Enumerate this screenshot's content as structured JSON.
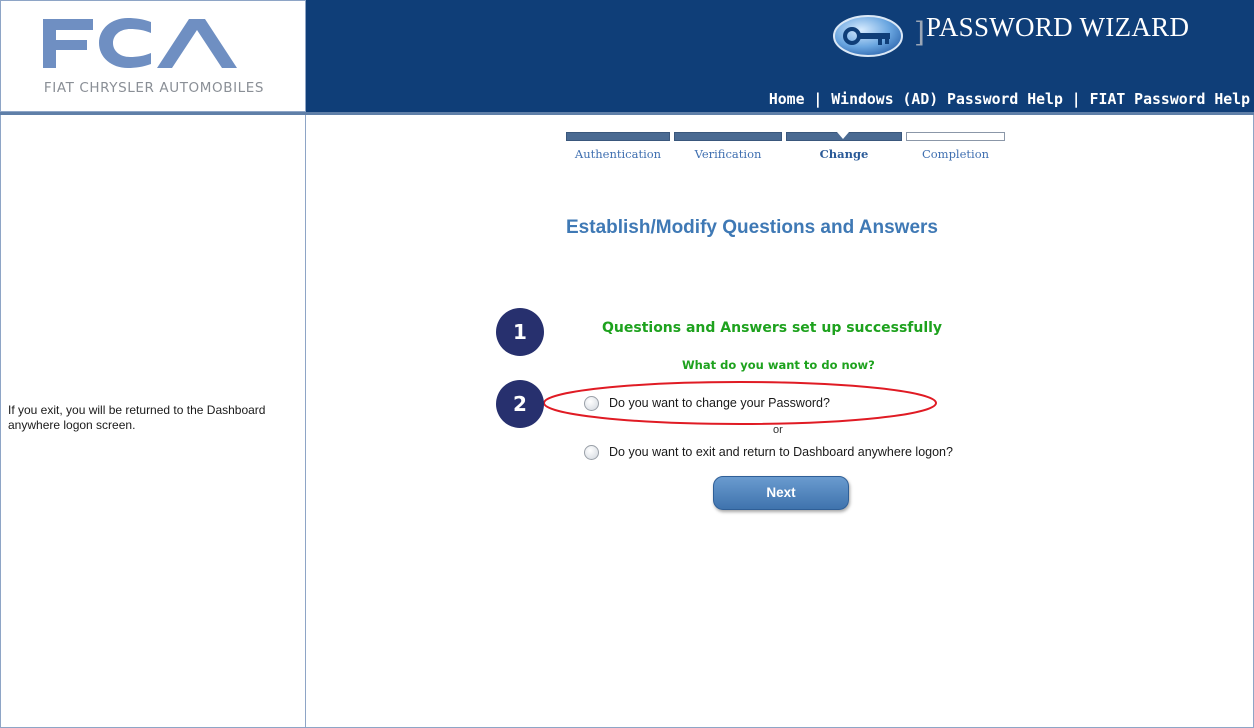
{
  "brand": {
    "logo_text": "FCA",
    "logo_subtitle": "FIAT CHRYSLER AUTOMOBILES",
    "wizard_title": "PASSWORD WIZARD",
    "banner_color": "#0f3e78"
  },
  "topnav": {
    "home": "Home",
    "sep": "|",
    "windows_help": "Windows (AD) Password Help",
    "fiat_help": "FIAT Password Help"
  },
  "steps": [
    {
      "label": "Authentication",
      "state": "done"
    },
    {
      "label": "Verification",
      "state": "done"
    },
    {
      "label": "Change",
      "state": "current"
    },
    {
      "label": "Completion",
      "state": "pending"
    }
  ],
  "left_panel": {
    "note": "If you exit, you will be returned to the Dashboard anywhere logon screen."
  },
  "main": {
    "heading": "Establish/Modify Questions and Answers",
    "success_message": "Questions and Answers set up successfully",
    "prompt": "What do you want to do now?",
    "options": [
      {
        "label": "Do you want to change your Password?",
        "selected": false
      },
      {
        "label": "Do you want to exit and return to Dashboard anywhere logon?",
        "selected": false
      }
    ],
    "or_text": "or",
    "next_label": "Next"
  },
  "callouts": {
    "badge_1": "1",
    "badge_2": "2",
    "highlight_color": "#e01b24",
    "badge_color": "#27306e"
  }
}
